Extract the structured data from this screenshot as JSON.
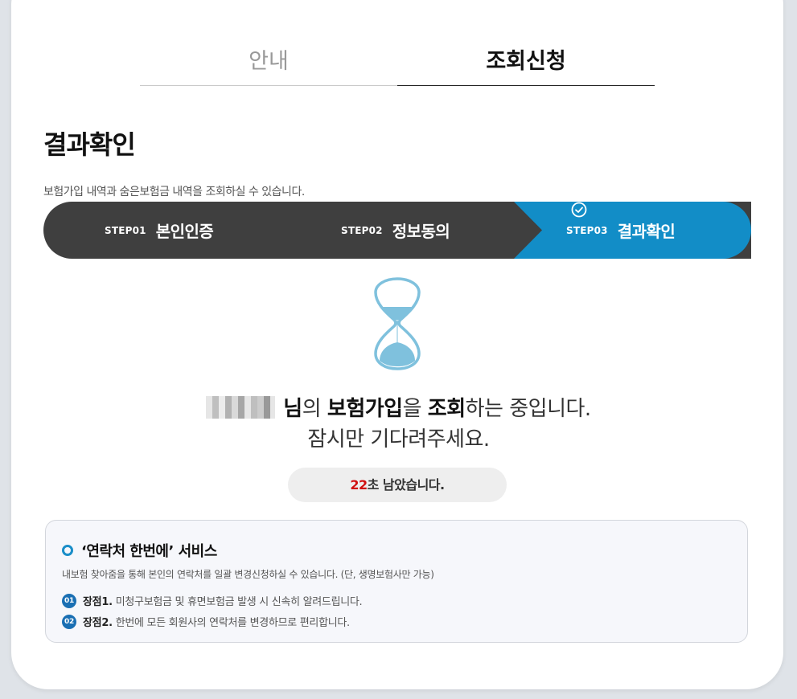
{
  "tabs": [
    {
      "label": "안내",
      "active": false
    },
    {
      "label": "조회신청",
      "active": true
    }
  ],
  "page": {
    "title": "결과확인",
    "description": "보험가입 내역과 숨은보험금 내역을 조회하실 수 있습니다."
  },
  "steps": [
    {
      "num": "STEP01",
      "label": "본인인증",
      "active": false
    },
    {
      "num": "STEP02",
      "label": "정보동의",
      "active": false
    },
    {
      "num": "STEP03",
      "label": "결과확인",
      "active": true,
      "icon": "check-circle-icon"
    }
  ],
  "colors": {
    "step_inactive": "#3f3f3f",
    "step_active": "#128dc7",
    "hourglass_sand": "#7fc1dd",
    "timer_seconds": "#d01010",
    "badge": "#1a6fb3"
  },
  "status": {
    "line1_suffix_1": "님",
    "line1_part_2": "의 ",
    "line1_bold_3": "보험가입",
    "line1_part_4": "을 ",
    "line1_bold_5": "조회",
    "line1_part_6": "하는 중입니다.",
    "line2": "잠시만 기다려주세요."
  },
  "timer": {
    "seconds": "22",
    "suffix": "초 남았습니다."
  },
  "service": {
    "title": "‘연락처 한번에’ 서비스",
    "description": "내보험 찾아줌을 통해 본인의 연락처를 일괄 변경신청하실 수 있습니다. (단, 생명보험사만 가능)",
    "advantages": [
      {
        "badge": "01",
        "key": "장점1.",
        "text": "미청구보험금 및 휴면보험금 발생 시 신속히 알려드립니다."
      },
      {
        "badge": "02",
        "key": "장점2.",
        "text": "한번에 모든 회원사의 연락처를 변경하므로 편리합니다."
      }
    ]
  }
}
